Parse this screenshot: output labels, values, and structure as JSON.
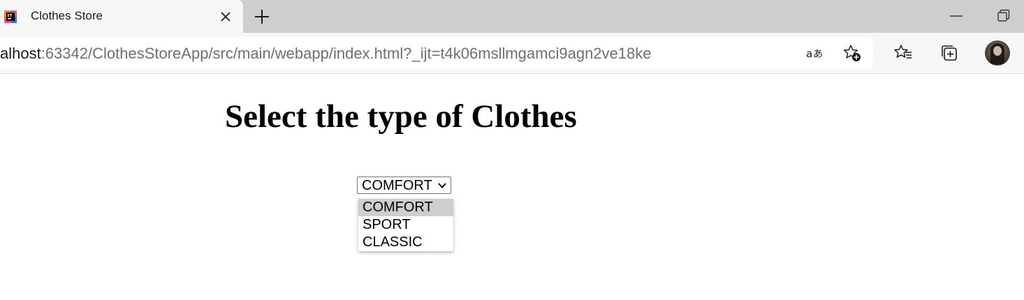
{
  "browser": {
    "tab_title": "Clothes Store",
    "url_host": "alhost",
    "url_rest": ":63342/ClothesStoreApp/src/main/webapp/index.html?_ijt=t4k06msllmgamci9agn2ve18ke",
    "icons": {
      "favicon": "intellij-icon",
      "tab_close": "close-icon",
      "new_tab": "plus-icon",
      "minimize": "minimize-icon",
      "restore": "restore-icon",
      "read_aloud": "translate-icon",
      "add_favorite": "star-add-icon",
      "favorites": "favorites-icon",
      "collections": "collections-icon",
      "profile": "avatar"
    }
  },
  "page": {
    "heading": "Select the type of Clothes",
    "select": {
      "value": "COMFORT",
      "options": [
        {
          "label": "COMFORT",
          "highlighted": true
        },
        {
          "label": "SPORT",
          "highlighted": false
        },
        {
          "label": "CLASSIC",
          "highlighted": false
        }
      ]
    }
  },
  "colors": {
    "tabstrip_bg": "#cecece",
    "toolbar_bg": "#f7f7f7",
    "option_highlight": "#cecece"
  }
}
